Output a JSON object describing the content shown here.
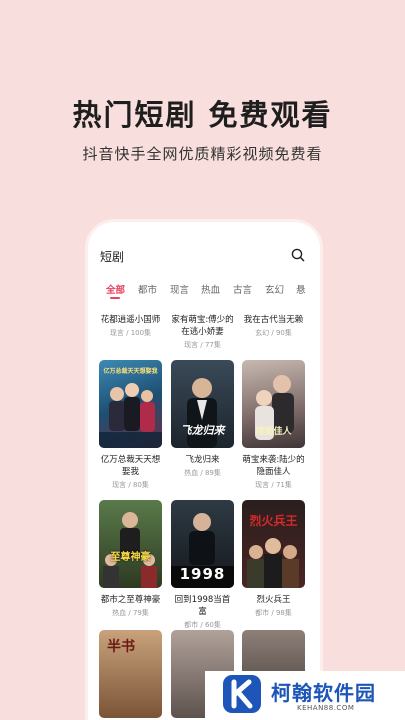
{
  "promo": {
    "headline": "热门短剧 免费观看",
    "subline": "抖音快手全网优质精彩视频免费看"
  },
  "header": {
    "title": "短剧",
    "search_icon": "search-icon"
  },
  "tabs": [
    "全部",
    "都市",
    "现言",
    "热血",
    "古言",
    "玄幻",
    "悬"
  ],
  "active_tab": 0,
  "top_row": [
    {
      "title": "花都逍遥小国师",
      "meta": "现言 / 100集"
    },
    {
      "title": "家有萌宝:傅少的在逃小娇妻",
      "meta": "现言 / 77集"
    },
    {
      "title": "我在古代当无赖",
      "meta": "玄幻 / 90集"
    }
  ],
  "row2": [
    {
      "title": "亿万总裁天天想娶我",
      "meta": "现言 / 80集"
    },
    {
      "title": "飞龙归来",
      "meta": "热血 / 89集"
    },
    {
      "title": "萌宝来袭:陆少的隐面佳人",
      "meta": "现言 / 71集"
    }
  ],
  "row3": [
    {
      "title": "都市之至尊神豪",
      "meta": "热血 / 79集"
    },
    {
      "title": "回到1998当首富",
      "meta": "都市 / 60集"
    },
    {
      "title": "烈火兵王",
      "meta": "都市 / 98集"
    }
  ],
  "posters": {
    "p1": "亿万总裁天天想娶我",
    "p2": "飞龙归来",
    "p3": "隐面佳人",
    "p4": "至尊神豪",
    "p5": "1998",
    "p6": "烈火兵王",
    "p7": "半书"
  },
  "watermark": {
    "name": "柯翰软件园",
    "url": "KEHAN88.COM",
    "logo_icon": "k-logo-icon"
  },
  "colors": {
    "background": "#f8dedc",
    "accent": "#e6455f",
    "watermark_blue": "#1d56b8"
  }
}
